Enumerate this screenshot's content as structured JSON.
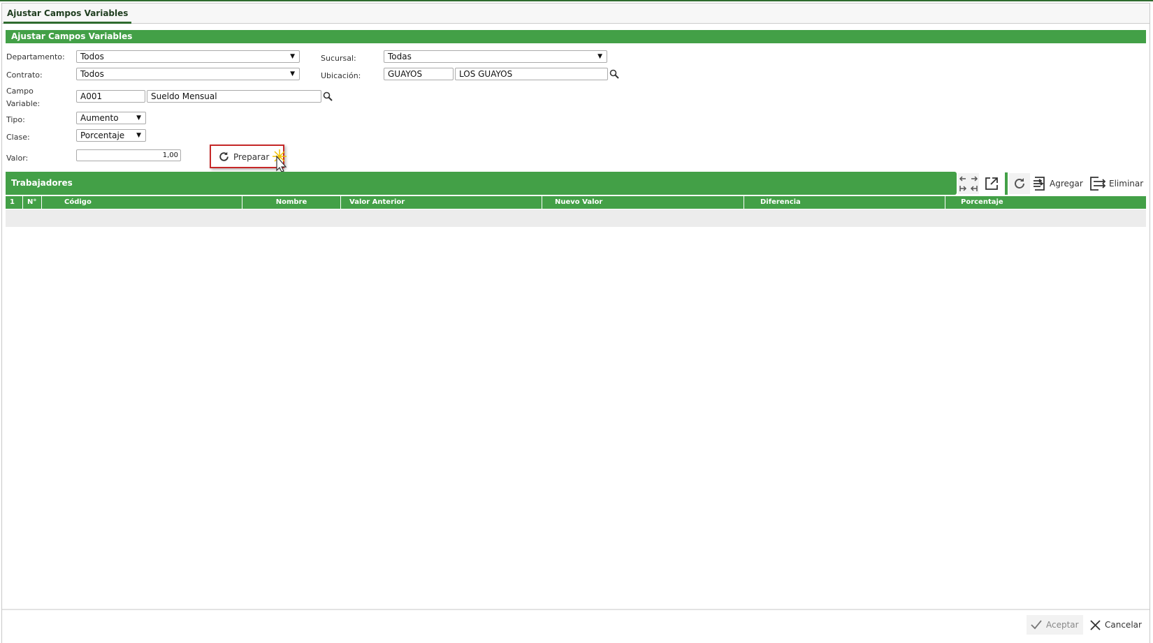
{
  "tab": {
    "title": "Ajustar Campos Variables"
  },
  "panel": {
    "title": "Ajustar Campos Variables"
  },
  "form": {
    "departamento": {
      "label": "Departamento:",
      "value": "Todos"
    },
    "contrato": {
      "label": "Contrato:",
      "value": "Todos"
    },
    "sucursal": {
      "label": "Sucursal:",
      "value": "Todas"
    },
    "ubicacion": {
      "label": "Ubicación:",
      "code": "GUAYOS",
      "name": "LOS GUAYOS"
    },
    "campo_variable": {
      "label_line1": "Campo",
      "label_line2": "Variable:",
      "code": "A001",
      "name": "Sueldo Mensual"
    },
    "tipo": {
      "label": "Tipo:",
      "value": "Aumento"
    },
    "clase": {
      "label": "Clase:",
      "value": "Porcentaje"
    },
    "valor": {
      "label": "Valor:",
      "value": "1,00"
    },
    "preparar_label": "Preparar"
  },
  "grid": {
    "title": "Trabajadores",
    "toolbar": {
      "agregar": "Agregar",
      "eliminar": "Eliminar"
    },
    "columns": [
      "1",
      "N°",
      "Código",
      "Nombre",
      "Valor Anterior",
      "Nuevo Valor",
      "Diferencia",
      "Porcentaje"
    ],
    "rows": []
  },
  "footer": {
    "aceptar": "Aceptar",
    "cancelar": "Cancelar"
  },
  "colors": {
    "accent": "#43a047",
    "highlight": "#c62828"
  }
}
